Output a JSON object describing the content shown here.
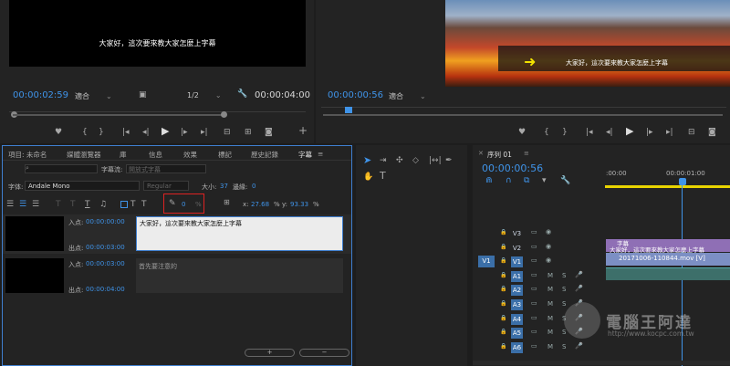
{
  "source_monitor": {
    "subtitle": "大家好，這次要來教大家怎麼上字幕",
    "timecode": "00:00:02:59",
    "fit_select": "適合",
    "quality_select": "1/2",
    "duration": "00:00:04:00"
  },
  "program_monitor": {
    "timecode": "00:00:00:56",
    "fit_select": "適合",
    "preview_subtitle": "大家好，這次要來教大家怎麼上字幕"
  },
  "captions_panel": {
    "tabs": [
      "項目: 未命名",
      "媒體瀏覽器",
      "庫",
      "信息",
      "效果",
      "標記",
      "歷史記錄",
      "字幕"
    ],
    "active_tab": "字幕",
    "caption_stream_label": "字幕流:",
    "caption_stream_value": "開放式字幕",
    "style_value": "Regular",
    "font_label": "字体:",
    "font_value": "Andale Mono",
    "size_label": "大小:",
    "size_value": "37",
    "edge_label": "邊緣:",
    "edge_value": "0",
    "opacity_value": "0",
    "opacity_unit": "%",
    "x_label": "x:",
    "x_value": "27.68",
    "x_unit": "%",
    "y_label": "y:",
    "y_value": "93.33",
    "y_unit": "%",
    "captions": [
      {
        "in_label": "入点:",
        "in": "00:00:00:00",
        "out_label": "出点:",
        "out": "00:00:03:00",
        "text": "大家好，這次要來教大家怎麼上字幕",
        "thumb_text": ""
      },
      {
        "in_label": "入点:",
        "in": "00:00:03:00",
        "out_label": "出点:",
        "out": "00:00:04:00",
        "text": "首先要注意的",
        "thumb_text": ""
      }
    ],
    "add_button": "+",
    "remove_button": "−"
  },
  "timeline": {
    "sequence_tab": "序列 01",
    "timecode": "00:00:00:56",
    "ruler_labels": [
      ":00:00",
      "00:00:01:00"
    ],
    "video_tracks": [
      "V3",
      "V2",
      "V1"
    ],
    "audio_tracks": [
      "A1",
      "A2",
      "A3",
      "A4",
      "A5",
      "A6"
    ],
    "source_patch_v": "V1",
    "clips": {
      "caption_track": "字幕",
      "caption_text": "大家好，這次要來教大家怎麼上字幕",
      "video_clip": "20171006-110844.mov [V]"
    },
    "track_toggles": {
      "mute": "M",
      "solo": "S"
    }
  },
  "watermark": {
    "name": "電腦王阿達",
    "url": "http://www.kocpc.com.tw"
  },
  "colors": {
    "accent": "#3f93e8",
    "caption_clip": "#8f6fb5",
    "video_clip": "#7c8fc4",
    "highlight_box": "#d22"
  }
}
